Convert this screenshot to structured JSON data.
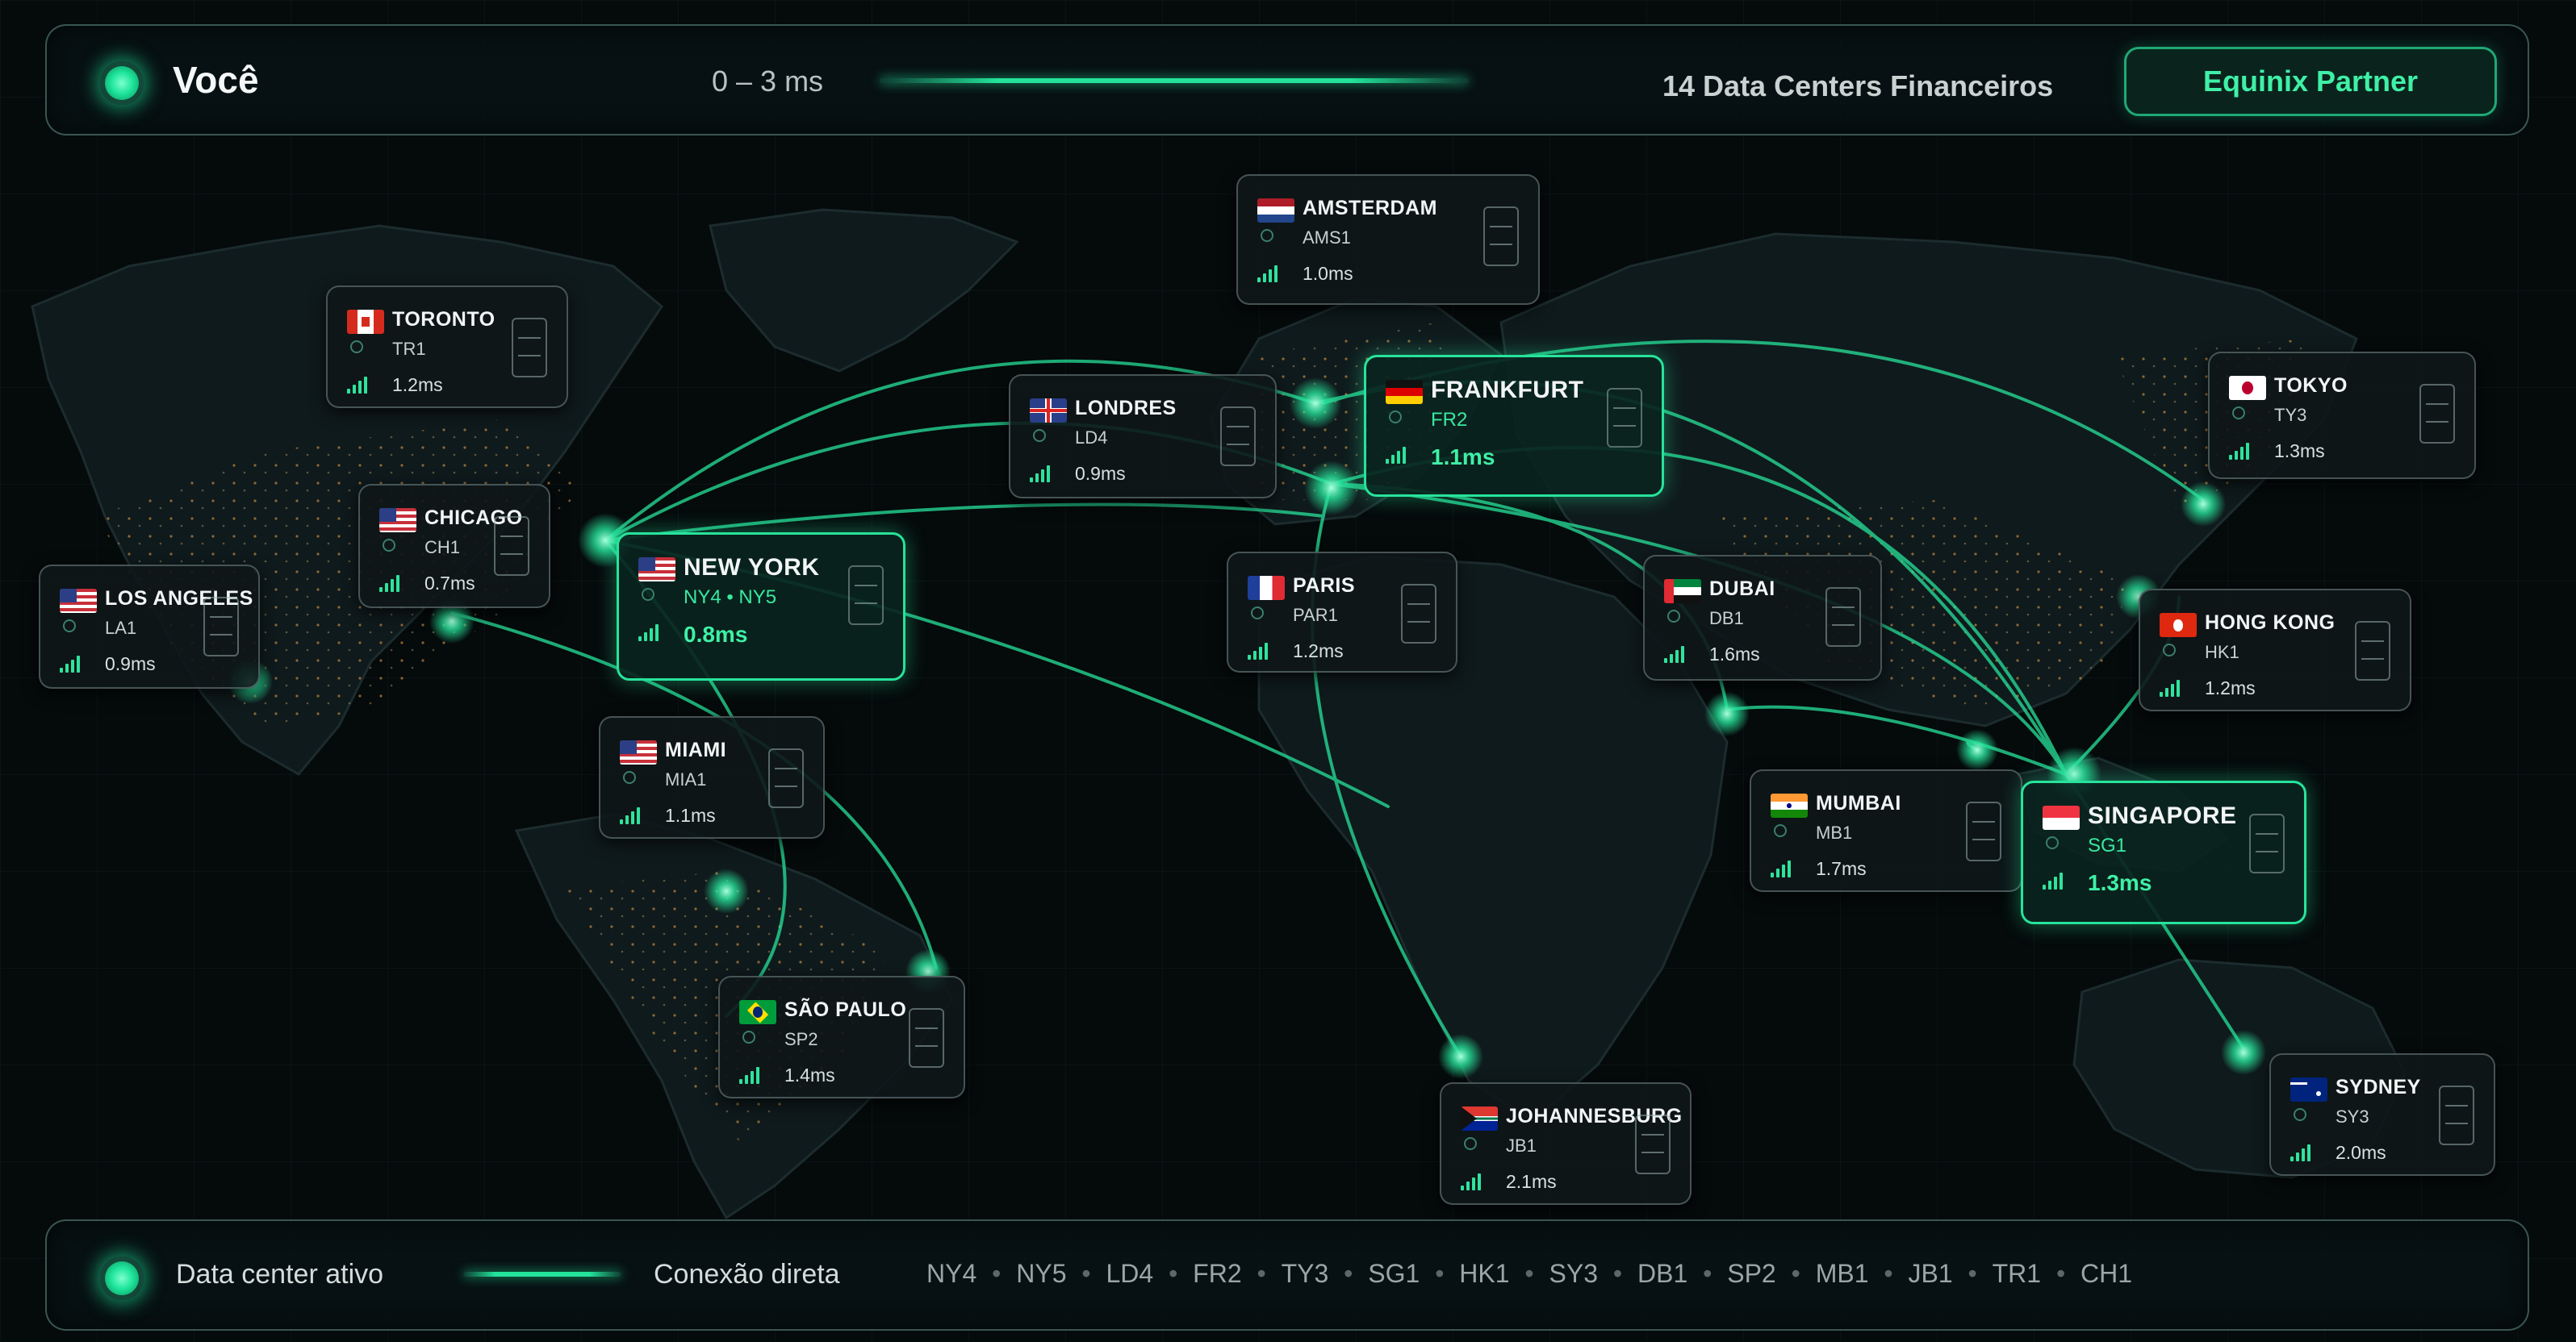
{
  "header": {
    "user_label": "Você",
    "latency_range": "0 – 3 ms",
    "datacenter_count": "14 Data Centers Financeiros",
    "partner_button": "Equinix Partner"
  },
  "legend": {
    "active_label": "Data center ativo",
    "connection_label": "Conexão direta",
    "codes": [
      "NY4",
      "NY5",
      "LD4",
      "FR2",
      "TY3",
      "SG1",
      "HK1",
      "SY3",
      "DB1",
      "SP2",
      "MB1",
      "JB1",
      "TR1",
      "CH1"
    ],
    "separator": "•"
  },
  "colors": {
    "accent": "#27e39b",
    "background": "#050a0b",
    "city_lights": "#f2a54a",
    "continent": "#101a1c"
  },
  "datacenters": [
    {
      "city": "TORONTO",
      "code": "TR1",
      "latency": "1.2ms",
      "flag": "ca",
      "highlight": false
    },
    {
      "city": "AMSTERDAM",
      "code": "AMS1",
      "latency": "1.0ms",
      "flag": "nl",
      "highlight": false
    },
    {
      "city": "LONDRES",
      "code": "LD4",
      "latency": "0.9ms",
      "flag": "gb",
      "highlight": false
    },
    {
      "city": "FRANKFURT",
      "code": "FR2",
      "latency": "1.1ms",
      "flag": "de",
      "highlight": true
    },
    {
      "city": "TOKYO",
      "code": "TY3",
      "latency": "1.3ms",
      "flag": "jp",
      "highlight": false
    },
    {
      "city": "CHICAGO",
      "code": "CH1",
      "latency": "0.7ms",
      "flag": "us",
      "highlight": false
    },
    {
      "city": "LOS ANGELES",
      "code": "LA1",
      "latency": "0.9ms",
      "flag": "us",
      "highlight": false
    },
    {
      "city": "NEW YORK",
      "code": "NY4 • NY5",
      "latency": "0.8ms",
      "flag": "us",
      "highlight": true
    },
    {
      "city": "PARIS",
      "code": "PAR1",
      "latency": "1.2ms",
      "flag": "fr",
      "highlight": false
    },
    {
      "city": "DUBAI",
      "code": "DB1",
      "latency": "1.6ms",
      "flag": "ae",
      "highlight": false
    },
    {
      "city": "HONG KONG",
      "code": "HK1",
      "latency": "1.2ms",
      "flag": "hk",
      "highlight": false
    },
    {
      "city": "MIAMI",
      "code": "MIA1",
      "latency": "1.1ms",
      "flag": "us",
      "highlight": false
    },
    {
      "city": "MUMBAI",
      "code": "MB1",
      "latency": "1.7ms",
      "flag": "in",
      "highlight": false
    },
    {
      "city": "SINGAPORE",
      "code": "SG1",
      "latency": "1.3ms",
      "flag": "sg",
      "highlight": true
    },
    {
      "city": "SÃO PAULO",
      "code": "SP2",
      "latency": "1.4ms",
      "flag": "br",
      "highlight": false
    },
    {
      "city": "JOHANNESBURG",
      "code": "JB1",
      "latency": "2.1ms",
      "flag": "za",
      "highlight": false
    },
    {
      "city": "SYDNEY",
      "code": "SY3",
      "latency": "2.0ms",
      "flag": "au",
      "highlight": false
    }
  ]
}
